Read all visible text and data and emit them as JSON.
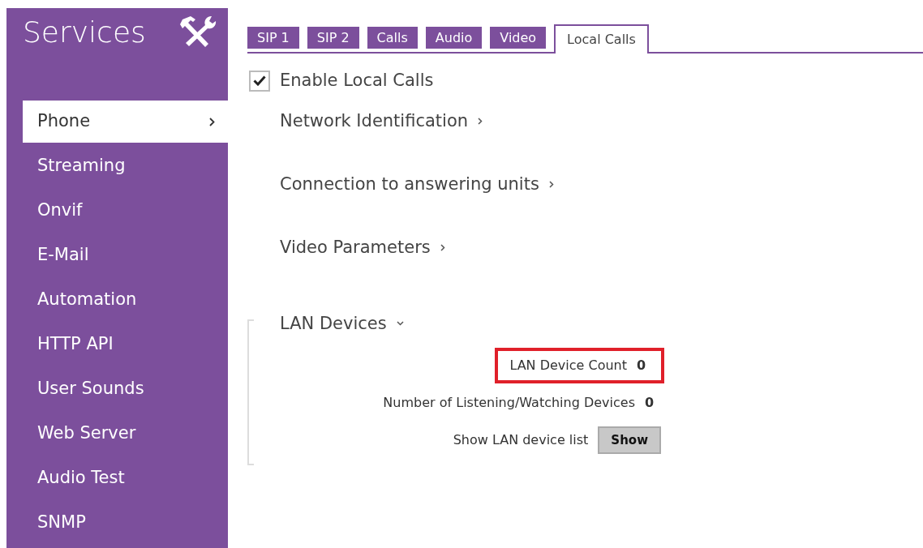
{
  "sidebar": {
    "title": "Services",
    "items": [
      {
        "label": "Phone",
        "selected": true
      },
      {
        "label": "Streaming",
        "selected": false
      },
      {
        "label": "Onvif",
        "selected": false
      },
      {
        "label": "E-Mail",
        "selected": false
      },
      {
        "label": "Automation",
        "selected": false
      },
      {
        "label": "HTTP API",
        "selected": false
      },
      {
        "label": "User Sounds",
        "selected": false
      },
      {
        "label": "Web Server",
        "selected": false
      },
      {
        "label": "Audio Test",
        "selected": false
      },
      {
        "label": "SNMP",
        "selected": false
      }
    ]
  },
  "tabs": [
    {
      "label": "SIP 1",
      "selected": false
    },
    {
      "label": "SIP 2",
      "selected": false
    },
    {
      "label": "Calls",
      "selected": false
    },
    {
      "label": "Audio",
      "selected": false
    },
    {
      "label": "Video",
      "selected": false
    },
    {
      "label": "Local Calls",
      "selected": true
    }
  ],
  "enable": {
    "label": "Enable Local Calls",
    "checked": true
  },
  "sections": [
    {
      "title": "Network Identification",
      "expanded": false
    },
    {
      "title": "Connection to answering units",
      "expanded": false
    },
    {
      "title": "Video Parameters",
      "expanded": false
    },
    {
      "title": "LAN Devices",
      "expanded": true,
      "rows": [
        {
          "kind": "value",
          "label": "LAN Device Count",
          "value": "0",
          "highlighted": true
        },
        {
          "kind": "value",
          "label": "Number of Listening/Watching Devices",
          "value": "0",
          "highlighted": false
        },
        {
          "kind": "button",
          "label": "Show LAN device list",
          "value": "Show",
          "highlighted": false
        }
      ]
    }
  ]
}
